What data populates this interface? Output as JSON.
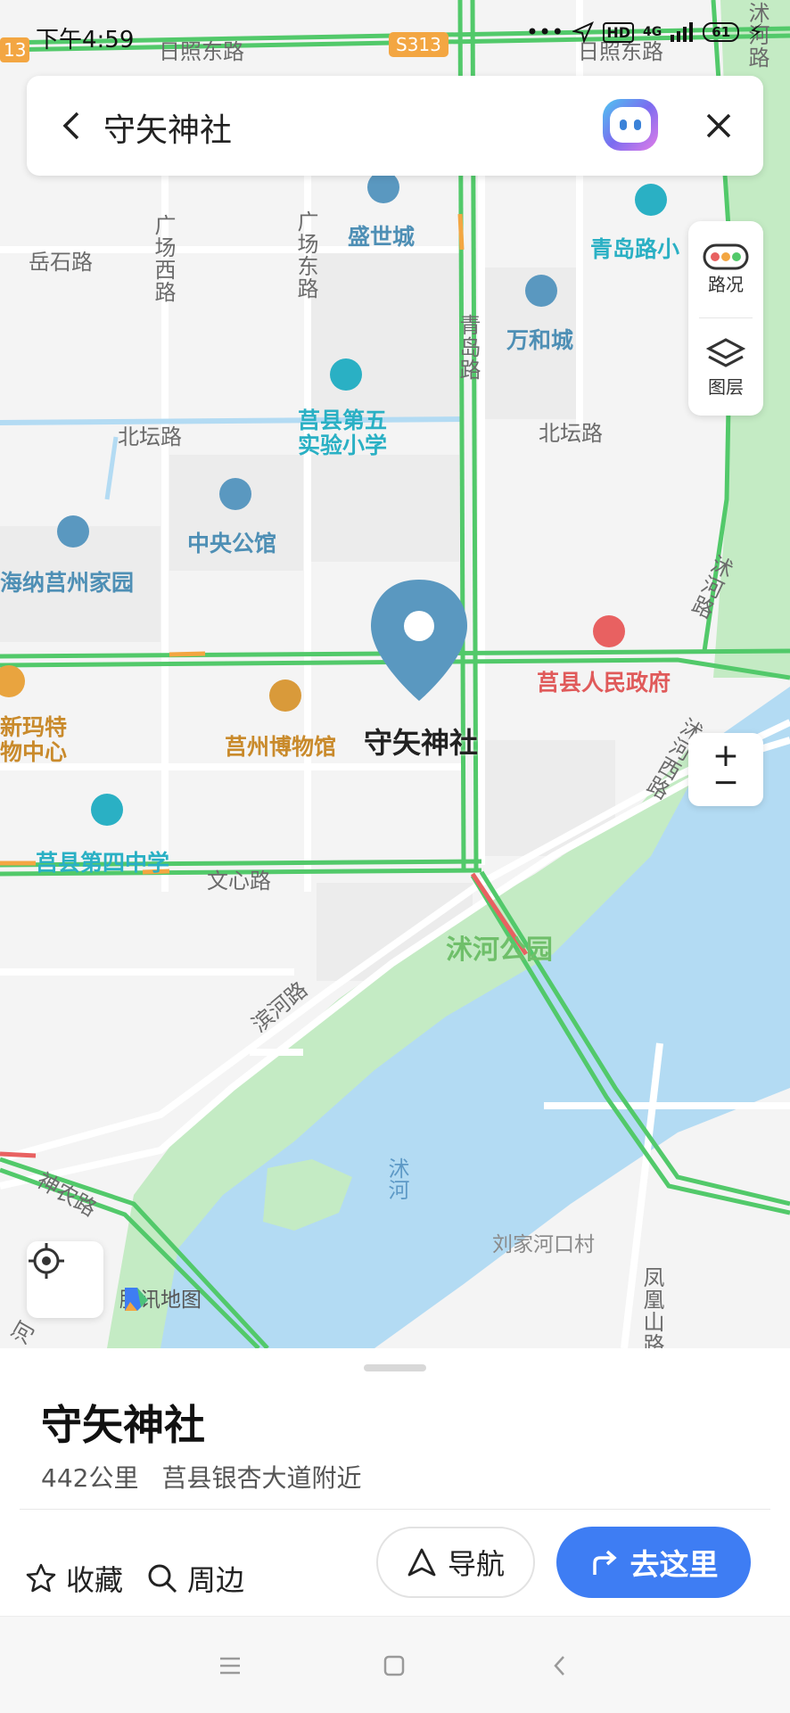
{
  "status_bar": {
    "time": "下午4:59",
    "network": "4G",
    "hd": "HD",
    "battery": "61"
  },
  "search": {
    "query": "守矢神社"
  },
  "side_panel": {
    "traffic_label": "路况",
    "layers_label": "图层"
  },
  "map": {
    "roads": {
      "rizhao_west": "日照东路",
      "rizhao_east": "日照东路",
      "s313": "S313",
      "n13": "13",
      "yueshi": "岳石路",
      "guangchang_west": "广场西路",
      "guangchang_east": "广场东路",
      "qingdao": "青岛路",
      "beitan_west": "北坛路",
      "beitan_east": "北坛路",
      "shuhe_top": "沭河路",
      "shuhe_right": "沭河路",
      "shuhe_west": "沭河西路",
      "wenxin": "文心路",
      "binhe": "滨河路",
      "shennong": "神农路",
      "fenghuangshan": "凤凰山路",
      "he_bottom": "河"
    },
    "pois": {
      "shengshicheng": "盛世城",
      "qingdaolu_school": "青岛路小",
      "wanhecheng": "万和城",
      "juxian_no5": "莒县第五\n实验小学",
      "zhongyang": "中央公馆",
      "haina": "海纳莒州家园",
      "government": "莒县人民政府",
      "museum": "莒州博物馆",
      "xinmate": "新玛特\n物中心",
      "juxian_no4": "莒县第四中学",
      "park": "沭河公园",
      "river": "沭河",
      "village": "刘家河口村"
    },
    "selected_pin": "守矢神社",
    "provider": "腾讯地图",
    "colors": {
      "road_green": "#52c96a",
      "water": "#b3dbf3",
      "park": "#c4ebc4",
      "pin": "#5a98c0"
    }
  },
  "sheet": {
    "title": "守矢神社",
    "distance": "442公里",
    "address": "莒县银杏大道附近",
    "favorite_label": "收藏",
    "nearby_label": "周边",
    "navigate_label": "导航",
    "go_label": "去这里"
  }
}
